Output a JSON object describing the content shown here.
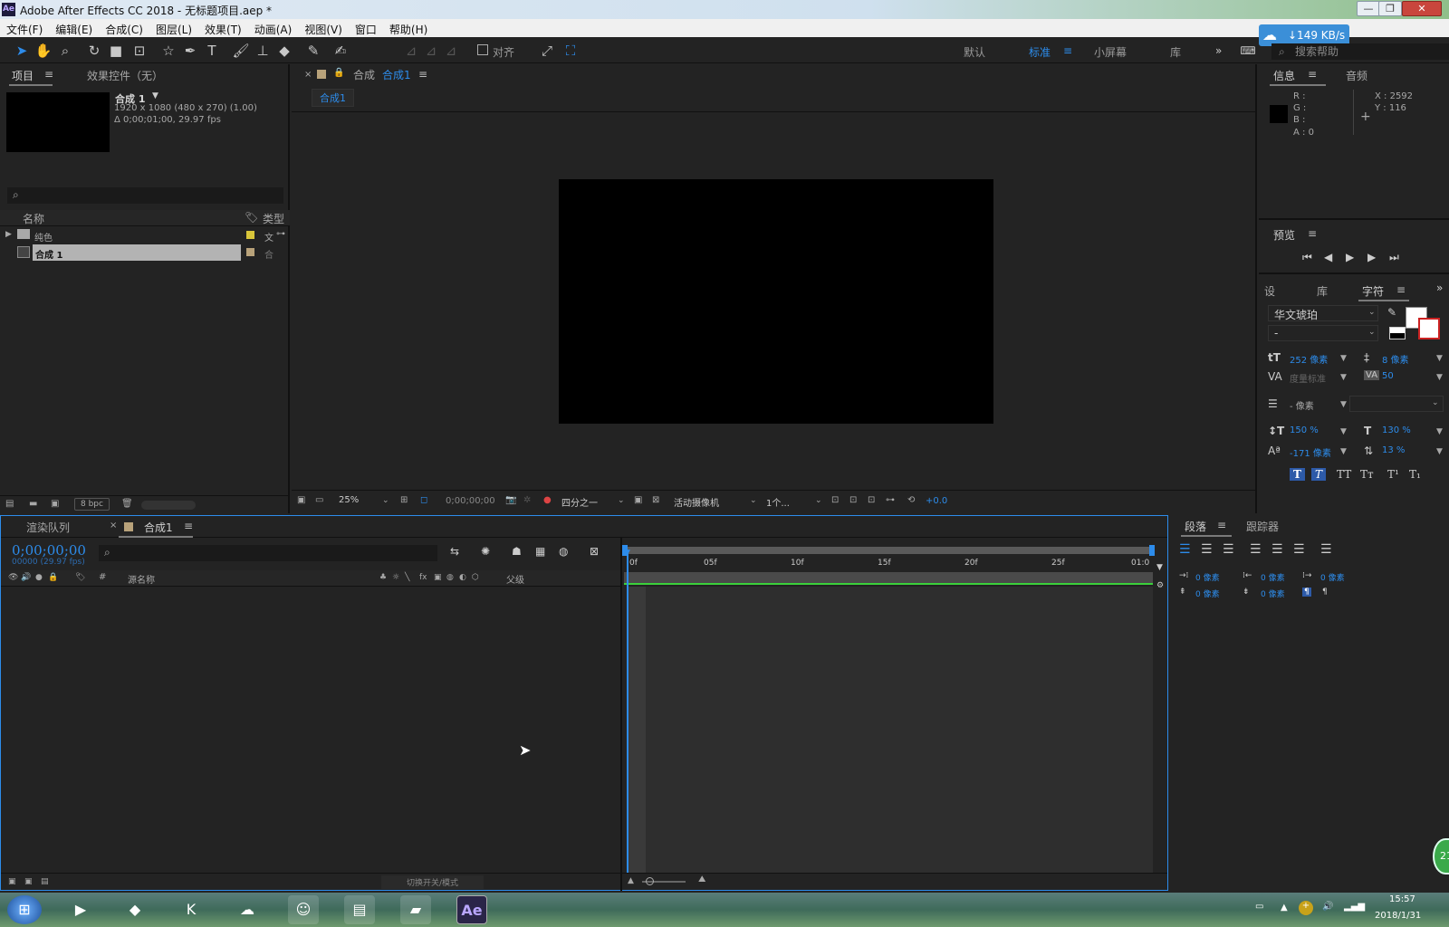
{
  "window": {
    "title": "Adobe After Effects CC 2018 - 无标题项目.aep *",
    "logo": "Ae"
  },
  "menu": [
    "文件(F)",
    "编辑(E)",
    "合成(C)",
    "图层(L)",
    "效果(T)",
    "动画(A)",
    "视图(V)",
    "窗口",
    "帮助(H)"
  ],
  "toolbar": {
    "align_label": "对齐",
    "workspaces": [
      "默认",
      "标准",
      "小屏幕",
      "库"
    ],
    "active_workspace": "标准",
    "search_placeholder": "搜索帮助",
    "net_speed": "↓149 KB/s"
  },
  "project_panel": {
    "tabs": [
      "项目",
      "效果控件（无）"
    ],
    "comp_name": "合成 1",
    "comp_info1": "1920 x 1080  (480 x 270) (1.00)",
    "comp_info2": "Δ 0;00;01;00, 29.97 fps",
    "col_name": "名称",
    "col_type": "类型",
    "items": [
      {
        "name": "纯色",
        "type": "文",
        "label_color": "#d8c53a"
      },
      {
        "name": "合成 1",
        "type": "合",
        "label_color": "#b8a27a"
      }
    ],
    "bpc": "8 bpc"
  },
  "comp_viewer": {
    "tab_prefix": "合成",
    "tab_name": "合成1",
    "breadcrumb": "合成1",
    "zoom": "25%",
    "timecode": "0;00;00;00",
    "resolution": "四分之一",
    "camera": "活动摄像机",
    "views": "1个...",
    "exposure": "+0.0"
  },
  "info_panel": {
    "tabs": [
      "信息",
      "音频"
    ],
    "r": "R :",
    "g": "G :",
    "b": "B :",
    "a": "A : 0",
    "x": "X : 2592",
    "y": "Y : 116"
  },
  "preview_panel": {
    "title": "预览"
  },
  "character_panel": {
    "tabs": [
      "设",
      "库",
      "字符"
    ],
    "font": "华文琥珀",
    "style": "-",
    "size": "252 像素",
    "leading": "8 像素",
    "kerning": "度量标准",
    "tracking": "50",
    "stroke": "- 像素",
    "vscale": "150 %",
    "hscale": "130 %",
    "baseline": "-171 像素",
    "tsume": "13 %",
    "styles": [
      "T",
      "T",
      "TT",
      "Tт",
      "T¹",
      "T₁"
    ]
  },
  "paragraph_panel": {
    "tabs": [
      "段落",
      "跟踪器"
    ],
    "indent_left": "0 像素",
    "indent_right": "0 像素",
    "indent_first": "0 像素",
    "space_before": "0 像素",
    "space_after": "0 像素"
  },
  "timeline": {
    "tabs": [
      "渲染队列",
      "合成1"
    ],
    "timecode": "0;00;00;00",
    "fps": "00000 (29.97 fps)",
    "col_source": "源名称",
    "col_parent": "父级",
    "ruler": [
      "0f",
      "05f",
      "10f",
      "15f",
      "20f",
      "25f",
      "01:0"
    ],
    "footer": "切换开关/模式"
  },
  "taskbar": {
    "time": "15:57",
    "date": "2018/1/31"
  },
  "badge_number": "21"
}
